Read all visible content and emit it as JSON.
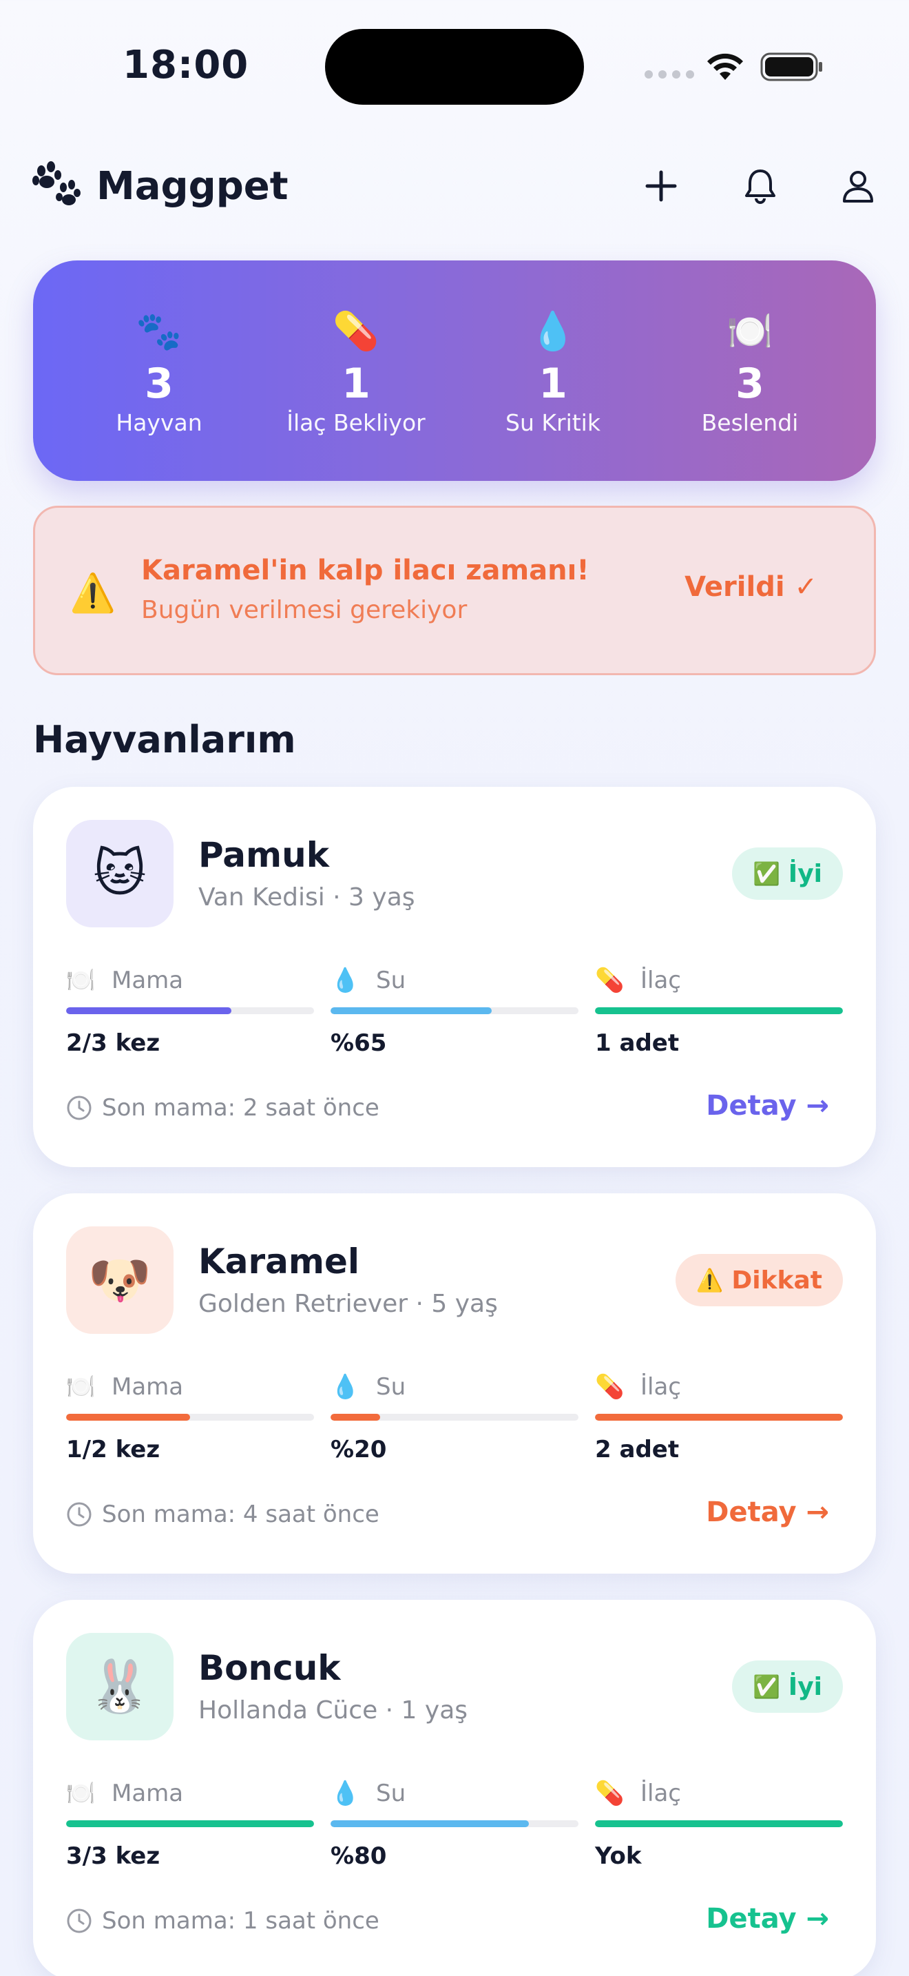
{
  "status_bar": {
    "time": "18:00"
  },
  "header": {
    "title": "Maggpet"
  },
  "summary": [
    {
      "icon": "🐾",
      "value": "3",
      "label": "Hayvan"
    },
    {
      "icon": "💊",
      "value": "1",
      "label": "İlaç Bekliyor"
    },
    {
      "icon": "💧",
      "value": "1",
      "label": "Su Kritik"
    },
    {
      "icon": "🍽️",
      "value": "3",
      "label": "Beslendi"
    }
  ],
  "alert": {
    "icon": "⚠️",
    "title": "Karamel'in kalp ilacı zamanı!",
    "subtitle": "Bugün verilmesi gerekiyor",
    "action": "Verildi ✓"
  },
  "section_title": "Hayvanlarım",
  "pets": [
    {
      "avatar": "🐱",
      "avatar_bg": "#ebe9fc",
      "name": "Pamuk",
      "breed": "Van Kedisi · 3 yaş",
      "badge_icon": "✅",
      "badge": "İyi",
      "badge_bg": "#dff6ef",
      "badge_color": "#11b886",
      "metrics": [
        {
          "icon": "🍽️",
          "label": "Mama",
          "value": "2/3 kez",
          "fill": 0.667,
          "color": "#6a63ec"
        },
        {
          "icon": "💧",
          "label": "Su",
          "value": "%65",
          "fill": 0.65,
          "color": "#5bb8ef"
        },
        {
          "icon": "💊",
          "label": "İlaç",
          "value": "1 adet",
          "fill": 1.0,
          "color": "#16c28f"
        }
      ],
      "last_fed": "Son mama: 2 saat önce",
      "detail": "Detay →",
      "detail_color": "#6a63ec"
    },
    {
      "avatar": "🐶",
      "avatar_bg": "#fde9e3",
      "name": "Karamel",
      "breed": "Golden Retriever · 5 yaş",
      "badge_icon": "⚠️",
      "badge": "Dikkat",
      "badge_bg": "#fde4dc",
      "badge_color": "#f06a3b",
      "metrics": [
        {
          "icon": "🍽️",
          "label": "Mama",
          "value": "1/2 kez",
          "fill": 0.5,
          "color": "#f26b3c"
        },
        {
          "icon": "💧",
          "label": "Su",
          "value": "%20",
          "fill": 0.2,
          "color": "#f26b3c"
        },
        {
          "icon": "💊",
          "label": "İlaç",
          "value": "2 adet",
          "fill": 1.0,
          "color": "#f26b3c"
        }
      ],
      "last_fed": "Son mama: 4 saat önce",
      "detail": "Detay →",
      "detail_color": "#f06a3b"
    },
    {
      "avatar": "🐰",
      "avatar_bg": "#dff6ef",
      "name": "Boncuk",
      "breed": "Hollanda Cüce · 1 yaş",
      "badge_icon": "✅",
      "badge": "İyi",
      "badge_bg": "#dff6ef",
      "badge_color": "#11b886",
      "metrics": [
        {
          "icon": "🍽️",
          "label": "Mama",
          "value": "3/3 kez",
          "fill": 1.0,
          "color": "#16c28f"
        },
        {
          "icon": "💧",
          "label": "Su",
          "value": "%80",
          "fill": 0.8,
          "color": "#5bb8ef"
        },
        {
          "icon": "💊",
          "label": "İlaç",
          "value": "Yok",
          "fill": 1.0,
          "color": "#16c28f"
        }
      ],
      "last_fed": "Son mama: 1 saat önce",
      "detail": "Detay →",
      "detail_color": "#16c28f"
    }
  ]
}
